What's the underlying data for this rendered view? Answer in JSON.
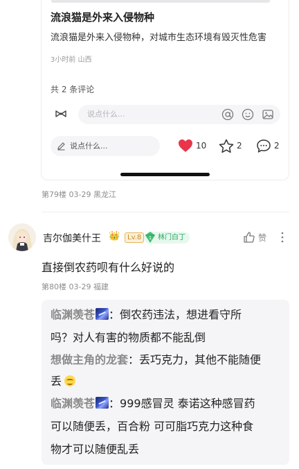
{
  "post_card": {
    "title": "流浪猫是外来入侵物种",
    "excerpt": "流浪猫是外来入侵物种，对城市生态环境有毁灭性危害",
    "meta": "3小时前 山西",
    "comment_count": "共 2 条评论",
    "input_placeholder": "说点什么...",
    "reply_placeholder": "说点什么...",
    "likes": "10",
    "favorites": "2",
    "comments": "2"
  },
  "floor79": {
    "meta": "第79楼  03-29  黑龙江"
  },
  "floor80": {
    "username": "吉尔伽美什王",
    "crown": "👑",
    "level": "Lv.8",
    "fan_level": "1",
    "fan_title": "林门白丁",
    "like_label": "赞",
    "text": "直接倒农药呗有什么好说的",
    "meta": "第80楼  03-29  福建",
    "replies": [
      {
        "name": "临渊羡苍",
        "sep": "：",
        "lines": [
          "倒农药违法，想进看守所",
          "吗？对人有害的物质都不能乱倒"
        ]
      },
      {
        "name": "想做主角的龙套",
        "sep": "：",
        "lines": [
          "丢巧克力，其他不能随便",
          "丢"
        ]
      },
      {
        "name": "临渊羡苍",
        "sep": "：",
        "lines": [
          "999感冒灵 泰诺这种感冒药",
          "可以随便丢，百合粉 可可脂巧克力这种食",
          "物才可以随便乱丢"
        ]
      }
    ]
  },
  "colors": {
    "heart": "#e8354a",
    "fan_badge": "#2ba55f",
    "level_badge": "#c88b22"
  }
}
